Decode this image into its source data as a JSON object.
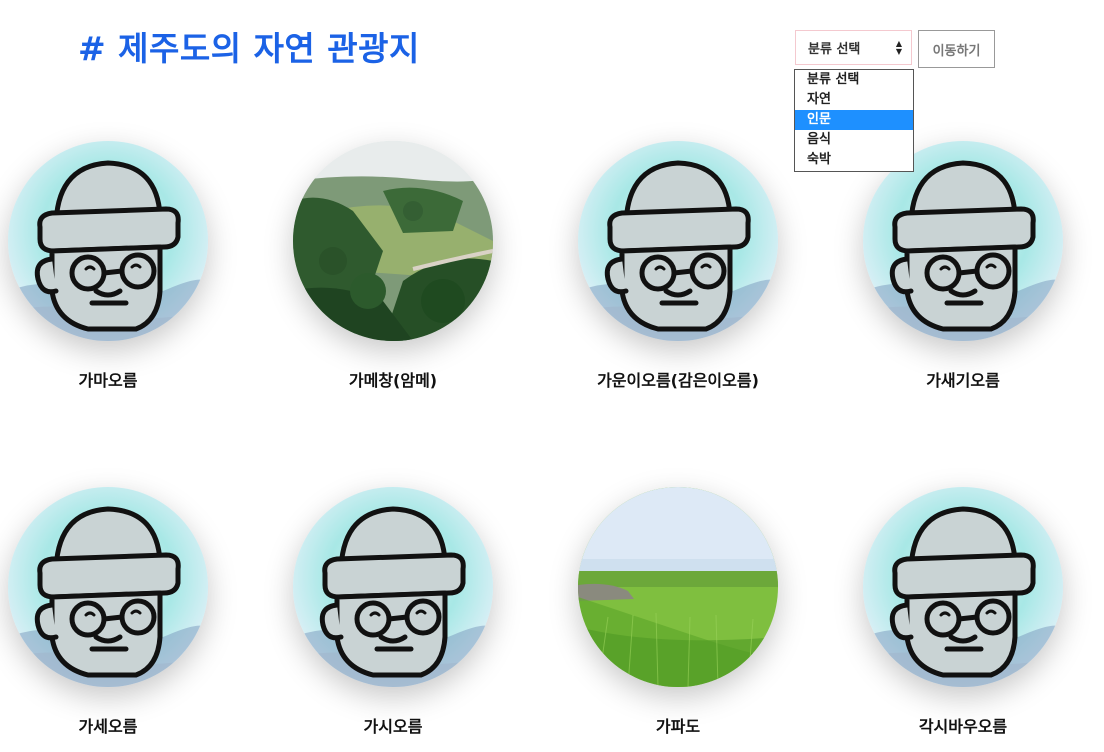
{
  "page": {
    "title": "# 제주도의 자연 관광지"
  },
  "category_select": {
    "selected_label": "분류 선택",
    "options": [
      "분류 선택",
      "자연",
      "인문",
      "음식",
      "숙박"
    ],
    "highlighted_option": "인문"
  },
  "go_button": {
    "label": "이동하기"
  },
  "places": [
    {
      "name": "가마오름",
      "image": "default-mascot"
    },
    {
      "name": "가메창(암메)",
      "image": "pine-forest-photo"
    },
    {
      "name": "가운이오름(감은이오름)",
      "image": "default-mascot"
    },
    {
      "name": "가새기오름",
      "image": "default-mascot"
    },
    {
      "name": "가세오름",
      "image": "default-mascot"
    },
    {
      "name": "가시오름",
      "image": "default-mascot"
    },
    {
      "name": "가파도",
      "image": "green-field-photo"
    },
    {
      "name": "각시바우오름",
      "image": "default-mascot"
    }
  ],
  "colors": {
    "title": "#1b62e6",
    "highlight": "#1e90ff"
  }
}
